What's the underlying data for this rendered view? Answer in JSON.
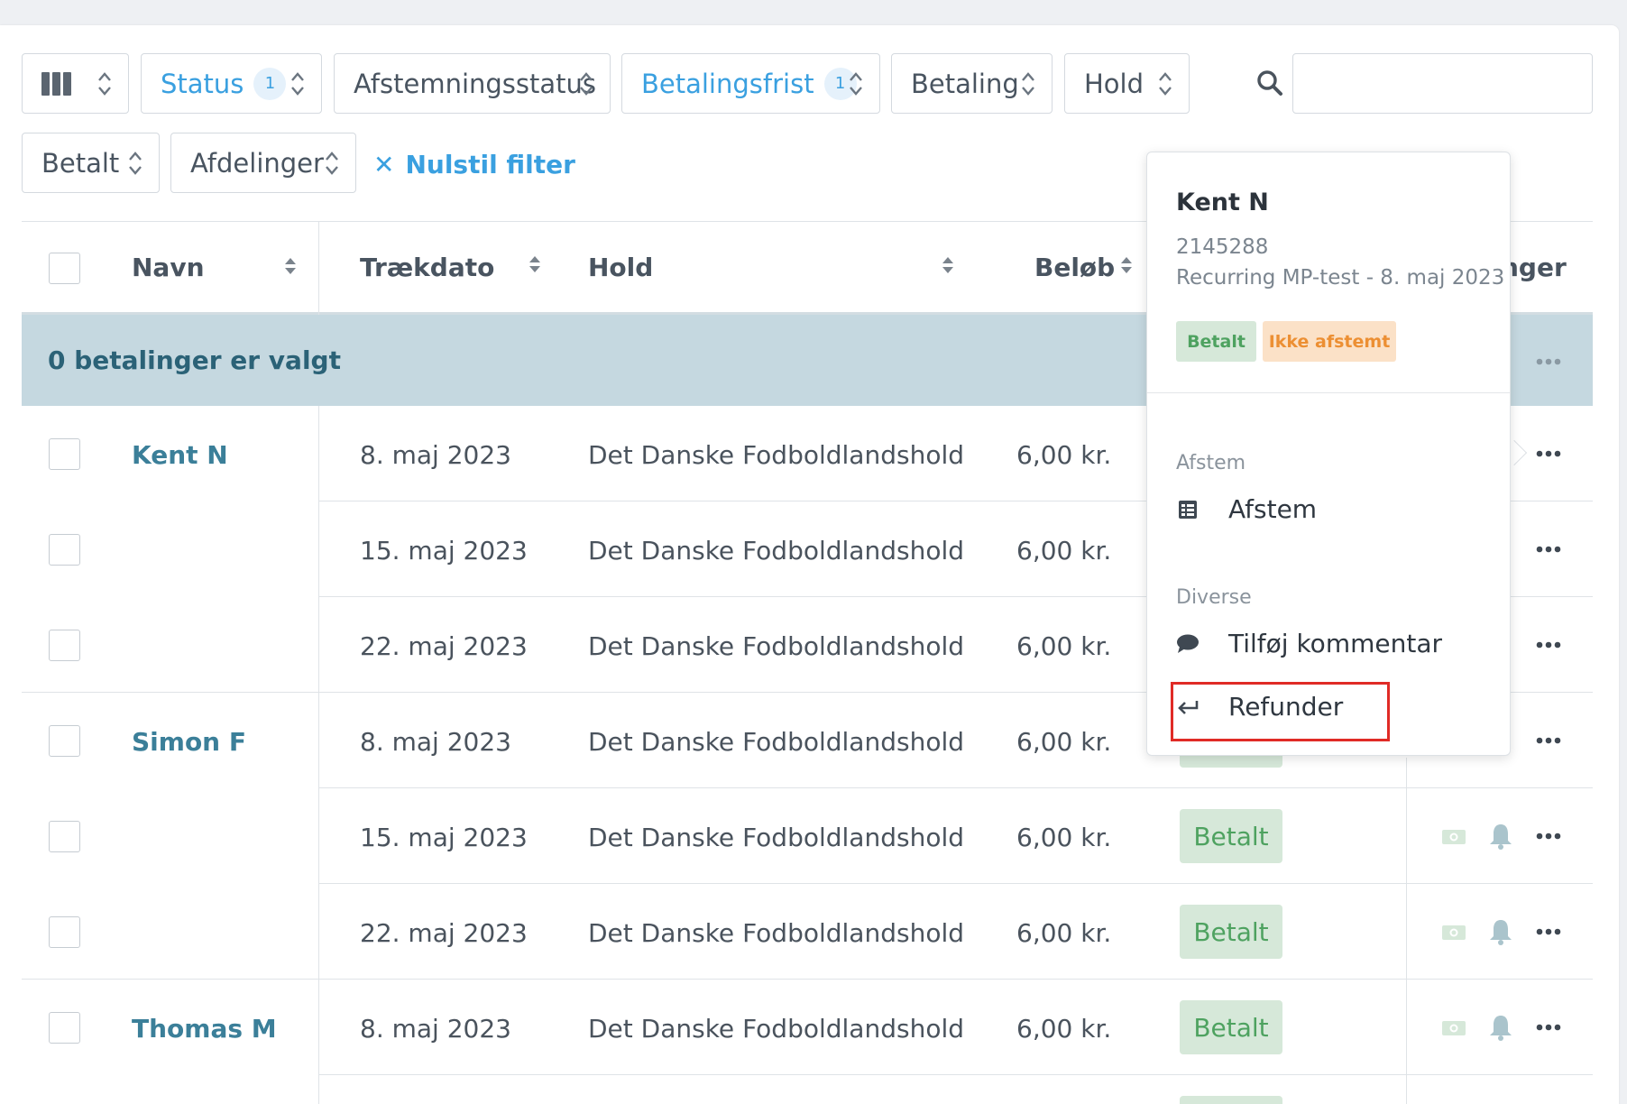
{
  "filters": {
    "row1": [
      {
        "label": "Status",
        "badge": "1",
        "active": true
      },
      {
        "label": "Afstemningsstatus",
        "active": false
      },
      {
        "label": "Betalingsfrist",
        "badge": "1",
        "active": true
      },
      {
        "label": "Betaling",
        "active": false
      },
      {
        "label": "Hold",
        "active": false
      }
    ],
    "row2": [
      {
        "label": "Betalt"
      },
      {
        "label": "Afdelinger"
      }
    ],
    "reset_label": "Nulstil filter",
    "search_placeholder": ""
  },
  "table": {
    "headers": {
      "name": "Navn",
      "date": "Trækdato",
      "team": "Hold",
      "amount": "Beløb",
      "actions_partial": "nger"
    },
    "selection_text": "0 betalinger er valgt",
    "rows": [
      {
        "name": "Kent N",
        "date": "8. maj 2023",
        "team": "Det Danske Fodboldlandshold",
        "amount": "6,00 kr.",
        "status": ""
      },
      {
        "name": "",
        "date": "15. maj 2023",
        "team": "Det Danske Fodboldlandshold",
        "amount": "6,00 kr.",
        "status": ""
      },
      {
        "name": "",
        "date": "22. maj 2023",
        "team": "Det Danske Fodboldlandshold",
        "amount": "6,00 kr.",
        "status": ""
      },
      {
        "name": "Simon F",
        "date": "8. maj 2023",
        "team": "Det Danske Fodboldlandshold",
        "amount": "6,00 kr.",
        "status": ""
      },
      {
        "name": "",
        "date": "15. maj 2023",
        "team": "Det Danske Fodboldlandshold",
        "amount": "6,00 kr.",
        "status": "Betalt"
      },
      {
        "name": "",
        "date": "22. maj 2023",
        "team": "Det Danske Fodboldlandshold",
        "amount": "6,00 kr.",
        "status": "Betalt"
      },
      {
        "name": "Thomas M",
        "date": "8. maj 2023",
        "team": "Det Danske Fodboldlandshold",
        "amount": "6,00 kr.",
        "status": "Betalt"
      }
    ]
  },
  "popover": {
    "name": "Kent N",
    "id": "2145288",
    "description": "Recurring MP-test - 8. maj 2023",
    "tag_paid": "Betalt",
    "tag_unreconciled": "Ikke afstemt",
    "section1": "Afstem",
    "item_reconcile": "Afstem",
    "section2": "Diverse",
    "item_comment": "Tilføj kommentar",
    "item_refund": "Refunder"
  },
  "colors": {
    "accent": "#3aa0e0",
    "name_link": "#3b7f99",
    "paid_bg": "#d6e8d9",
    "paid_text": "#4ea260",
    "unreconciled_bg": "#fbe1c7",
    "unreconciled_text": "#ec8f33",
    "selection_bar": "#c5d8e0",
    "highlight": "#e02b26"
  },
  "icons": {
    "columns": "columns-icon",
    "search": "search-icon",
    "sort": "sort-icon",
    "more": "more-icon",
    "money": "money-icon",
    "bell": "bell-icon",
    "reconcile": "reconcile-icon",
    "comment": "comment-icon",
    "refund": "refund-icon"
  }
}
